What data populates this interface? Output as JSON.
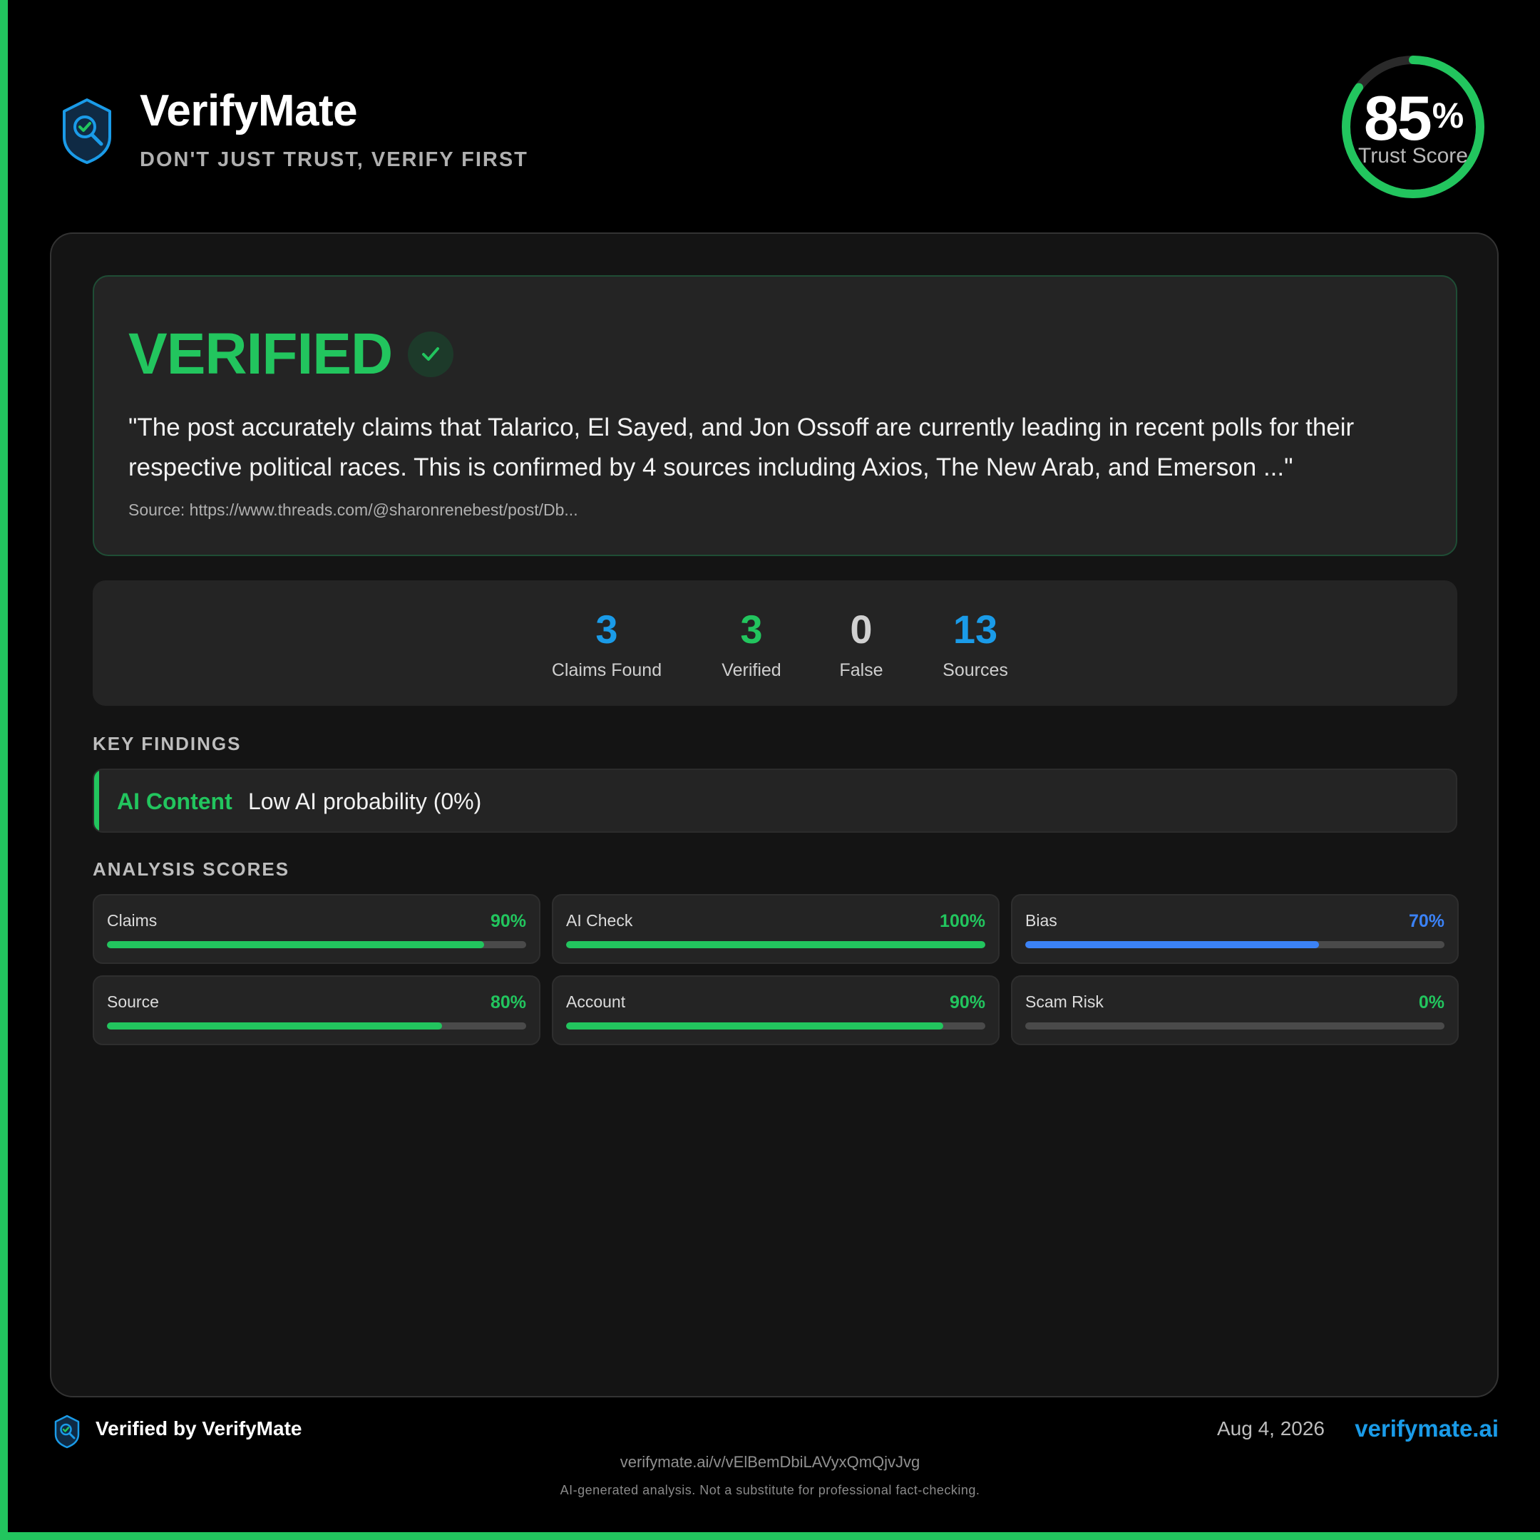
{
  "brand": {
    "name": "VerifyMate",
    "tagline": "DON'T JUST TRUST, VERIFY FIRST"
  },
  "trust_score": {
    "value": "85",
    "unit": "%",
    "label": "Trust Score",
    "fraction": 0.85,
    "color": "#22c55e"
  },
  "verdict": {
    "title": "VERIFIED",
    "icon": "check-icon",
    "summary": "\"The post accurately claims that Talarico, El Sayed, and Jon Ossoff are currently leading in recent polls for their respective political races. This is confirmed by 4 sources including Axios, The New Arab, and Emerson ...\"",
    "source": "Source: https://www.threads.com/@sharonrenebest/post/Db..."
  },
  "stats": [
    {
      "value": "3",
      "label": "Claims Found",
      "color": "#1a9be8"
    },
    {
      "value": "3",
      "label": "Verified",
      "color": "#22c55e"
    },
    {
      "value": "0",
      "label": "False",
      "color": "#d0d0d0"
    },
    {
      "value": "13",
      "label": "Sources",
      "color": "#1a9be8"
    }
  ],
  "key_findings": {
    "heading": "KEY FINDINGS",
    "items": [
      {
        "type": "AI Content",
        "text": "Low AI probability (0%)"
      }
    ]
  },
  "analysis_scores": {
    "heading": "ANALYSIS SCORES",
    "items": [
      {
        "label": "Claims",
        "value": "90%",
        "fraction": 0.9,
        "color": "#22c55e"
      },
      {
        "label": "AI Check",
        "value": "100%",
        "fraction": 1.0,
        "color": "#22c55e"
      },
      {
        "label": "Bias",
        "value": "70%",
        "fraction": 0.7,
        "color": "#3b82f6"
      },
      {
        "label": "Source",
        "value": "80%",
        "fraction": 0.8,
        "color": "#22c55e"
      },
      {
        "label": "Account",
        "value": "90%",
        "fraction": 0.9,
        "color": "#22c55e"
      },
      {
        "label": "Scam Risk",
        "value": "0%",
        "fraction": 0.0,
        "color": "#22c55e"
      }
    ]
  },
  "footer": {
    "verified_by": "Verified by VerifyMate",
    "date": "Aug 4, 2026",
    "domain": "verifymate.ai",
    "link": "verifymate.ai/v/vElBemDbiLAVyxQmQjvJvg",
    "disclaimer": "AI-generated analysis. Not a substitute for professional fact-checking."
  },
  "colors": {
    "accent_green": "#22c55e",
    "accent_blue": "#1a9be8",
    "bias_blue": "#3b82f6"
  }
}
